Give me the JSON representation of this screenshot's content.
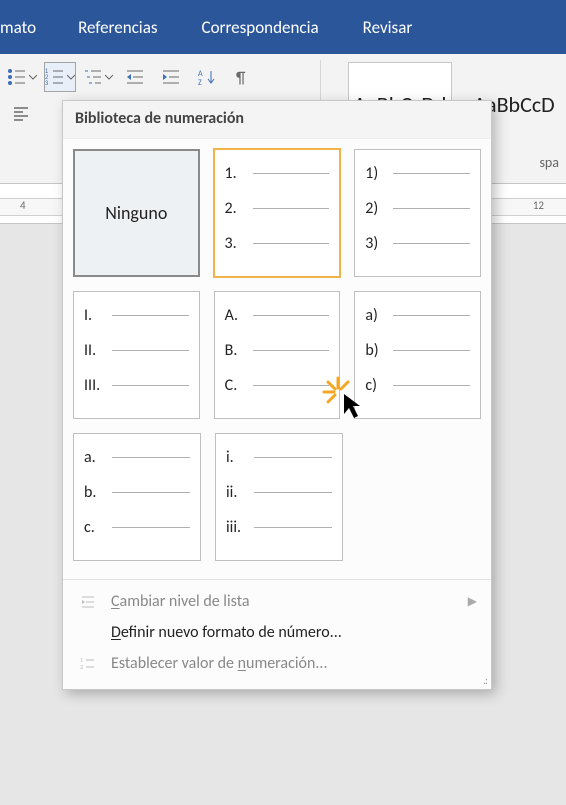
{
  "ribbon": {
    "tabs": {
      "cut": "mato",
      "referencias": "Referencias",
      "correspondencia": "Correspondencia",
      "revisar": "Revisar"
    },
    "styles": {
      "sample": "AaBbCcDd",
      "sample2": "AaBbCcD",
      "spacing_label_frag": "spa"
    }
  },
  "ruler": {
    "left_num": "4",
    "right_num": "12"
  },
  "dropdown": {
    "header": "Biblioteca de numeración",
    "ninguno": "Ninguno",
    "formats": {
      "decimal_dot": {
        "a": "1.",
        "b": "2.",
        "c": "3."
      },
      "decimal_paren": {
        "a": "1)",
        "b": "2)",
        "c": "3)"
      },
      "roman_upper": {
        "a": "I.",
        "b": "II.",
        "c": "III."
      },
      "alpha_upper": {
        "a": "A.",
        "b": "B.",
        "c": "C."
      },
      "alpha_lower_paren": {
        "a": "a)",
        "b": "b)",
        "c": "c)"
      },
      "alpha_lower_dot": {
        "a": "a.",
        "b": "b.",
        "c": "c."
      },
      "roman_lower": {
        "a": "i.",
        "b": "ii.",
        "c": "iii."
      }
    },
    "menu": {
      "change_level": "Cambiar nivel de lista",
      "define_new": "Definir nuevo formato de número...",
      "set_value": "Establecer valor de numeración...",
      "underline_letters": {
        "change": "C",
        "define": "D",
        "set": "n"
      }
    }
  }
}
